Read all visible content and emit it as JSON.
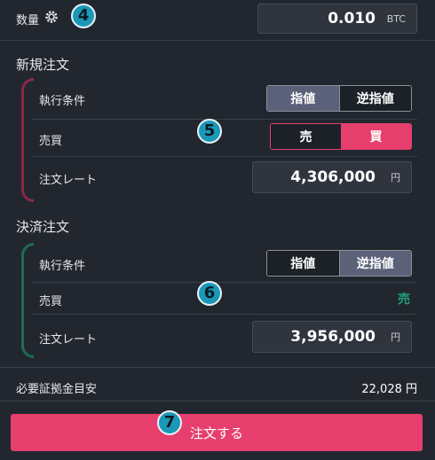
{
  "quantity": {
    "label": "数量",
    "value": "0.010",
    "unit": "BTC",
    "badge": "4"
  },
  "new_order": {
    "title": "新規注文",
    "condition_label": "執行条件",
    "condition_options": [
      "指値",
      "逆指値"
    ],
    "side_label": "売買",
    "side_options": [
      "売",
      "買"
    ],
    "rate_label": "注文レート",
    "rate_value": "4,306,000",
    "rate_unit": "円",
    "badge": "5"
  },
  "settlement": {
    "title": "決済注文",
    "condition_label": "執行条件",
    "condition_options": [
      "指値",
      "逆指値"
    ],
    "side_label": "売買",
    "side_value": "売",
    "rate_label": "注文レート",
    "rate_value": "3,956,000",
    "rate_unit": "円",
    "badge": "6"
  },
  "margin": {
    "label": "必要証拠金目安",
    "value": "22,028 円"
  },
  "submit": {
    "label": "注文する",
    "badge": "7"
  },
  "colors": {
    "accent_buy": "#e63f6e",
    "settle_bracket": "#1f6b57",
    "new_bracket": "#8b2a45",
    "active_seg": "#5a6178",
    "badge": "#1b98b8"
  }
}
